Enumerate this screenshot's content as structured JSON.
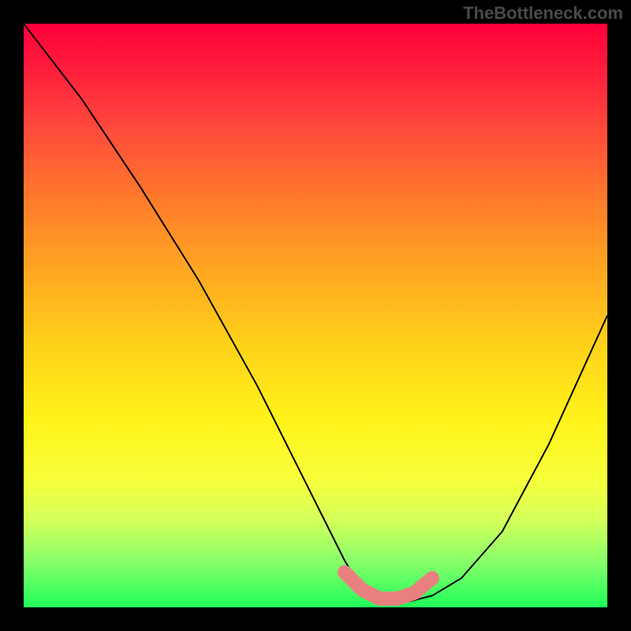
{
  "watermark": "TheBottleneck.com",
  "chart_data": {
    "type": "line",
    "title": "",
    "xlabel": "",
    "ylabel": "",
    "xlim": [
      0,
      100
    ],
    "ylim": [
      0,
      100
    ],
    "series": [
      {
        "name": "bottleneck-curve",
        "x": [
          0,
          10,
          20,
          30,
          40,
          50,
          55,
          58,
          62,
          66,
          70,
          75,
          82,
          90,
          100
        ],
        "y": [
          100,
          87,
          72,
          56,
          38,
          18,
          8,
          3,
          1,
          1,
          2,
          5,
          13,
          28,
          50
        ]
      }
    ],
    "highlight": {
      "name": "optimal-zone",
      "x": [
        55,
        58,
        61,
        64,
        67,
        70
      ],
      "y": [
        6,
        3,
        1.5,
        1.5,
        2.5,
        5
      ],
      "color": "#e88080"
    },
    "gradient_stops": [
      {
        "pos": 0,
        "color": "#ff003a"
      },
      {
        "pos": 8,
        "color": "#ff1e3c"
      },
      {
        "pos": 18,
        "color": "#ff4a3c"
      },
      {
        "pos": 30,
        "color": "#ff7a2a"
      },
      {
        "pos": 42,
        "color": "#ffa621"
      },
      {
        "pos": 55,
        "color": "#ffd21a"
      },
      {
        "pos": 68,
        "color": "#fff31a"
      },
      {
        "pos": 78,
        "color": "#f7ff3a"
      },
      {
        "pos": 85,
        "color": "#d4ff5a"
      },
      {
        "pos": 92,
        "color": "#8aff6a"
      },
      {
        "pos": 100,
        "color": "#1fff5a"
      }
    ]
  }
}
